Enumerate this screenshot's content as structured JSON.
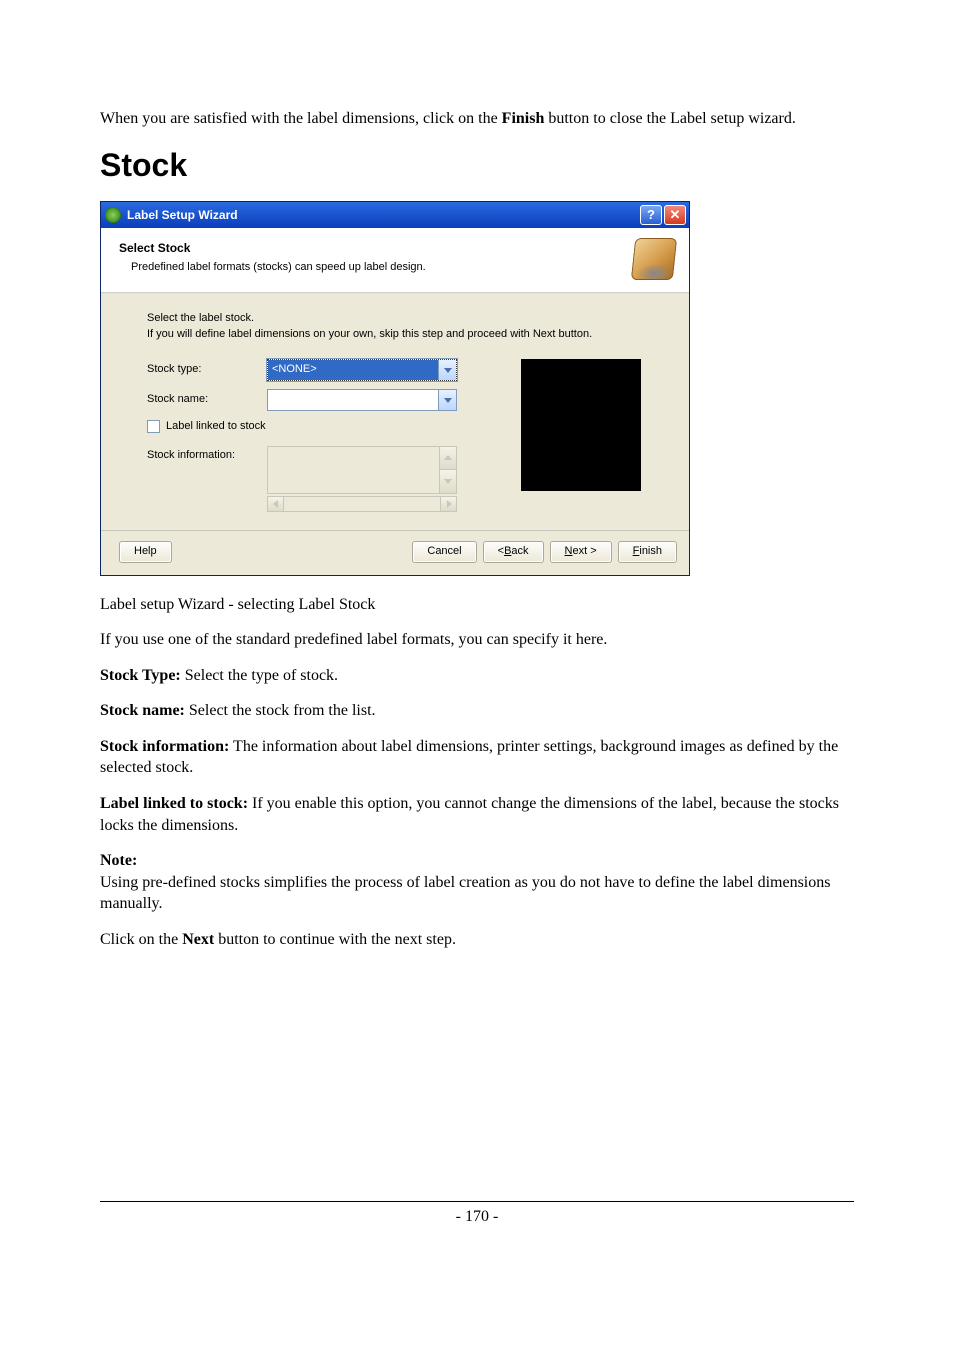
{
  "intro": {
    "line1_pre": "When you are satisfied with the label dimensions, click on the ",
    "line1_bold": "Finish",
    "line1_post": " button to close the Label setup wizard."
  },
  "section_heading": "Stock",
  "dialog": {
    "title": "Label Setup Wizard",
    "help_glyph": "?",
    "close_glyph": "✕",
    "header_title": "Select Stock",
    "header_sub": "Predefined label formats (stocks) can speed up label design.",
    "instr_line1": "Select the label stock.",
    "instr_line2": "If you will define label dimensions on your own, skip this step and proceed with Next button.",
    "stock_type_label": "Stock type:",
    "stock_type_value": "<NONE>",
    "stock_name_label": "Stock name:",
    "stock_name_value": "",
    "label_linked": "Label linked to stock",
    "stock_info_label": "Stock information:",
    "btn_help": "Help",
    "btn_cancel": "Cancel",
    "btn_back_u": "B",
    "btn_back_rest": "ack",
    "btn_back_prefix": "< ",
    "btn_next_u": "N",
    "btn_next_rest": "ext >",
    "btn_finish_u": "F",
    "btn_finish_rest": "inish"
  },
  "caption": "Label setup Wizard - selecting Label Stock",
  "para_predef": "If you use one of the standard predefined label formats, you can specify it here.",
  "stock_type": {
    "label": "Stock Type:",
    "text": " Select the type of stock."
  },
  "stock_name": {
    "label": "Stock name:",
    "text": " Select the stock from the list."
  },
  "stock_info": {
    "label": "Stock information:",
    "text": " The information about label dimensions, printer settings, background images as defined by the selected stock."
  },
  "label_linked": {
    "label": "Label linked to stock:",
    "text": " If you enable this option, you cannot change the dimensions of the label, because the stocks locks the dimensions."
  },
  "note": {
    "label": "Note:",
    "text": " Using pre-defined stocks simplifies the process of label creation as you do not have to define the label dimensions manually."
  },
  "closing": {
    "pre": "Click on the ",
    "bold": "Next",
    "post": " button to continue with the next step."
  },
  "page_number": "- 170 -"
}
